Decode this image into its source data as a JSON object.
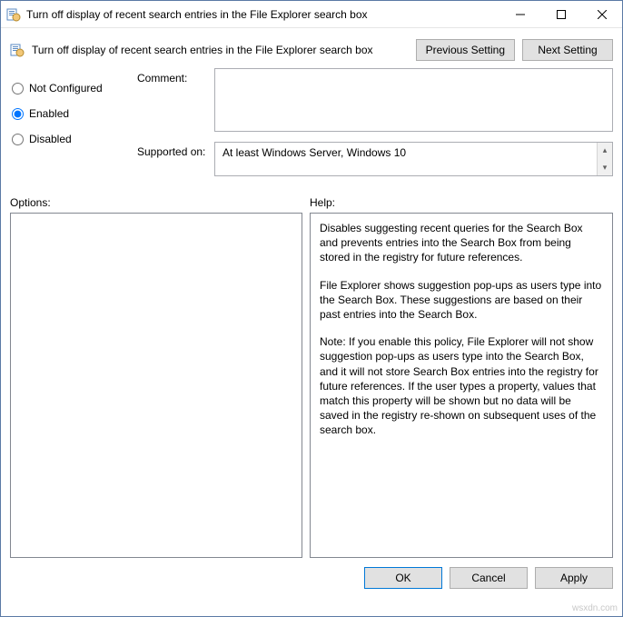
{
  "window": {
    "title": "Turn off display of recent search entries in the File Explorer search box"
  },
  "header": {
    "title": "Turn off display of recent search entries in the File Explorer search box",
    "prev_btn": "Previous Setting",
    "next_btn": "Next Setting"
  },
  "state": {
    "not_configured_label": "Not Configured",
    "enabled_label": "Enabled",
    "disabled_label": "Disabled",
    "comment_label": "Comment:",
    "supported_label": "Supported on:",
    "supported_value": "At least Windows Server, Windows 10",
    "comment_value": ""
  },
  "labels": {
    "options": "Options:",
    "help": "Help:"
  },
  "help": {
    "p1": "Disables suggesting recent queries for the Search Box and prevents entries into the Search Box from being stored in the registry for future references.",
    "p2": "File Explorer shows suggestion pop-ups as users type into the Search Box.  These suggestions are based on their past entries into the Search Box.",
    "p3": "Note: If you enable this policy, File Explorer will not show suggestion pop-ups as users type into the Search Box, and it will not store Search Box entries into the registry for future references.  If the user types a property, values that match this property will be shown but no data will be saved in the registry re-shown on subsequent uses of the search box."
  },
  "footer": {
    "ok": "OK",
    "cancel": "Cancel",
    "apply": "Apply"
  },
  "watermark": "wsxdn.com"
}
